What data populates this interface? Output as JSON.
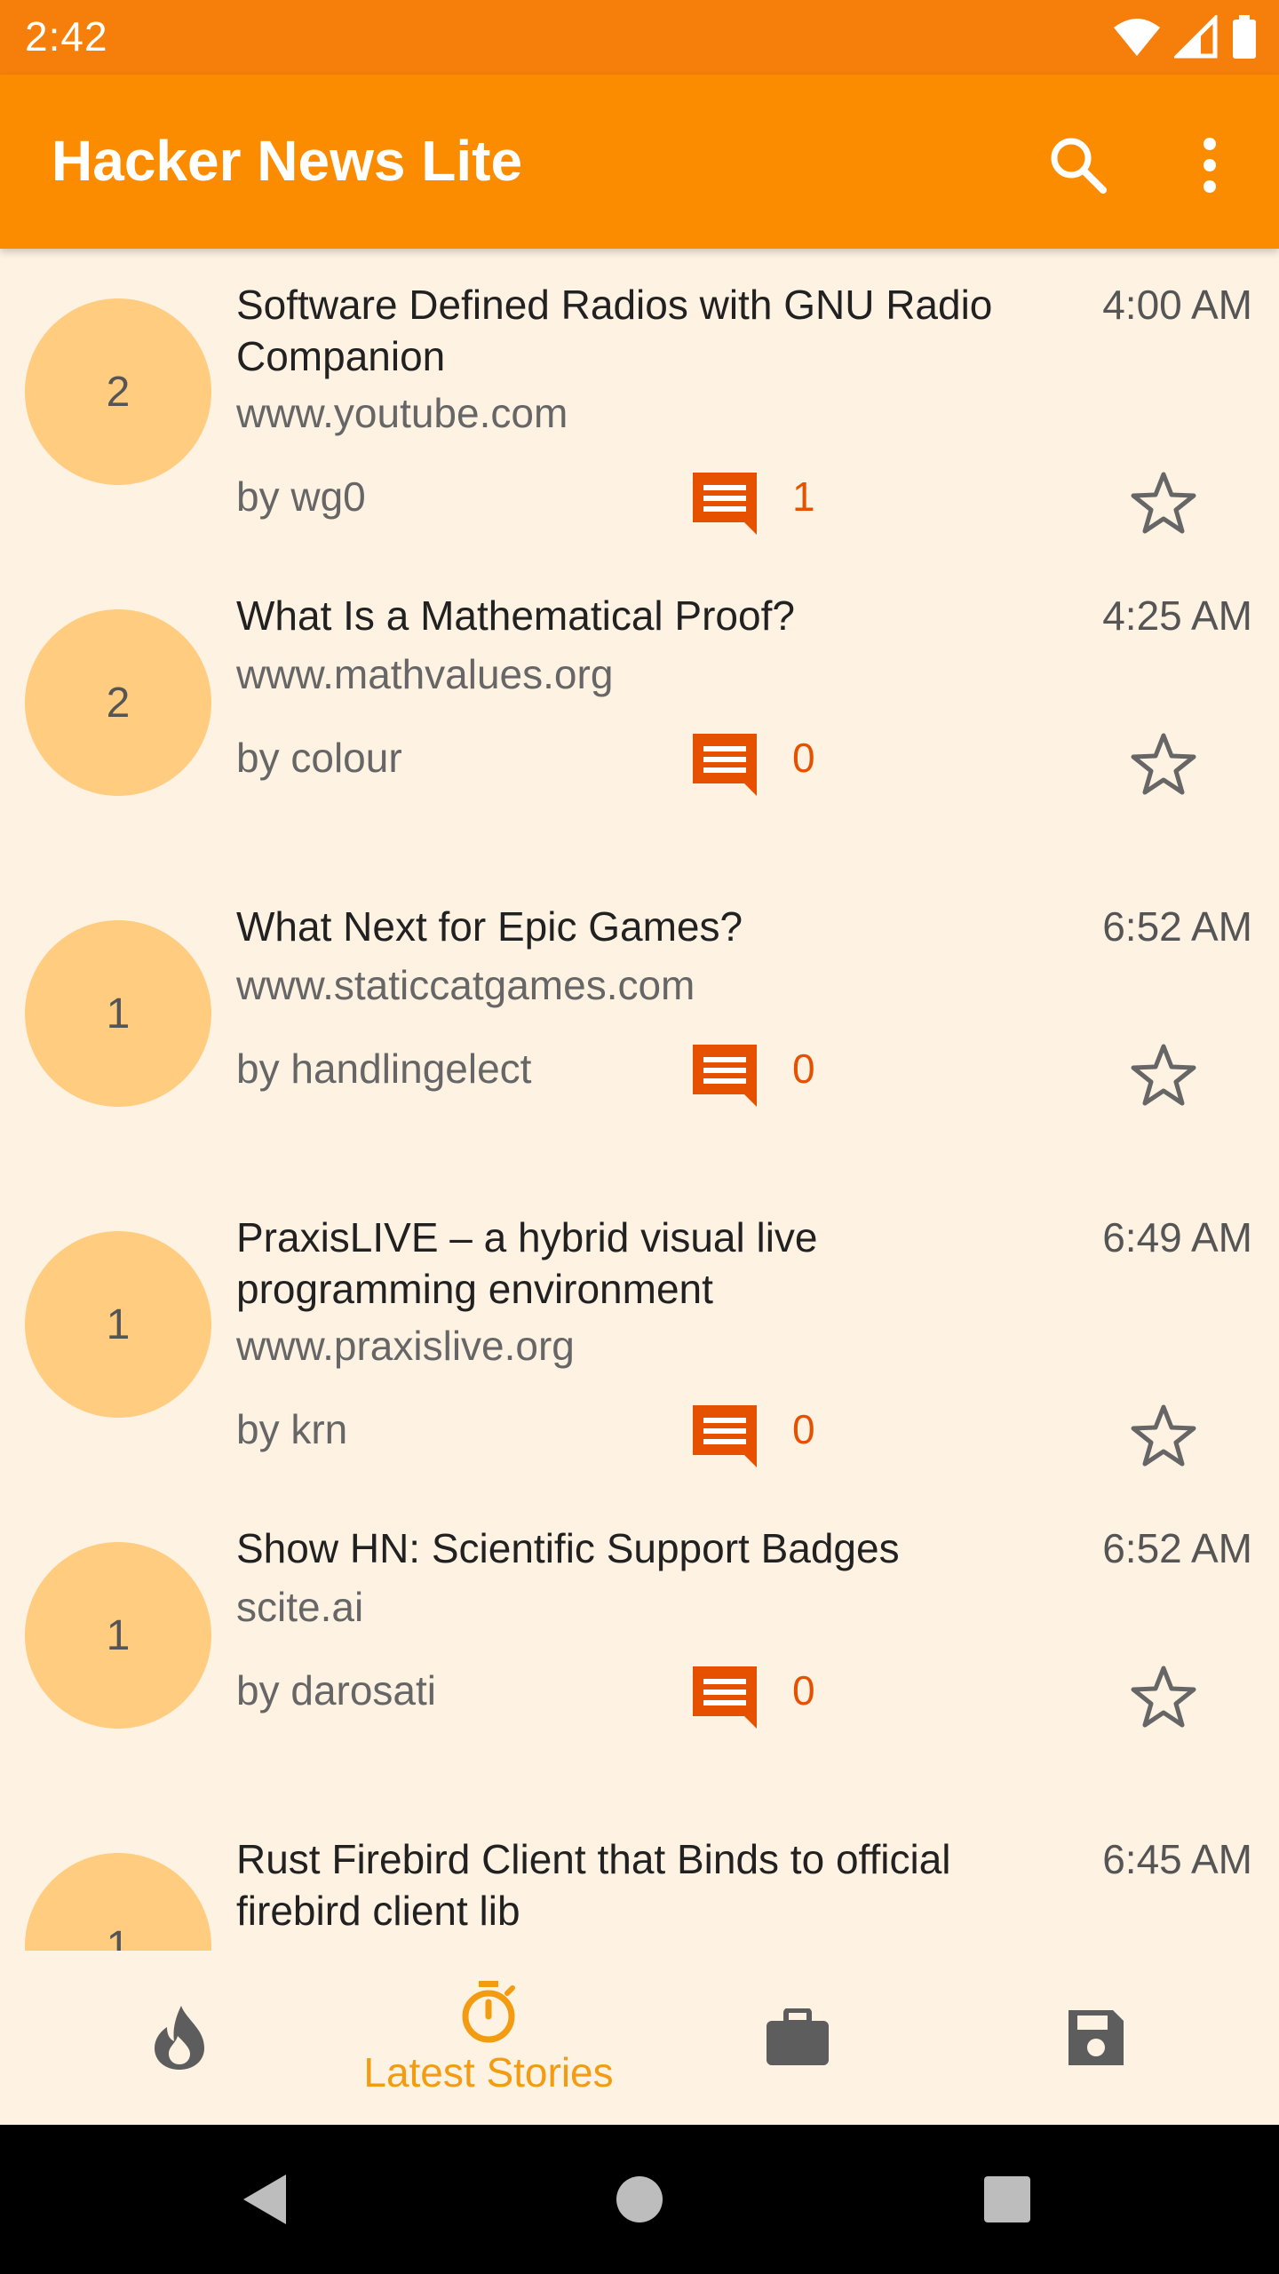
{
  "status_bar": {
    "time": "2:42"
  },
  "app_bar": {
    "title": "Hacker News Lite"
  },
  "stories": [
    {
      "score": "2",
      "title": "Software Defined Radios with GNU Radio Companion",
      "time": "4:00 AM",
      "domain": "www.youtube.com",
      "author": "by wg0",
      "comments": "1"
    },
    {
      "score": "2",
      "title": "What Is a Mathematical Proof?",
      "time": "4:25 AM",
      "domain": "www.mathvalues.org",
      "author": "by colour",
      "comments": "0"
    },
    {
      "score": "1",
      "title": "What Next for Epic Games?",
      "time": "6:52 AM",
      "domain": "www.staticcatgames.com",
      "author": "by handlingelect",
      "comments": "0"
    },
    {
      "score": "1",
      "title": "PraxisLIVE – a hybrid visual live programming environment",
      "time": "6:49 AM",
      "domain": "www.praxislive.org",
      "author": "by krn",
      "comments": "0"
    },
    {
      "score": "1",
      "title": "Show HN: Scientific Support Badges",
      "time": "6:52 AM",
      "domain": "scite.ai",
      "author": "by darosati",
      "comments": "0"
    },
    {
      "score": "1",
      "title": "Rust Firebird Client that Binds to official firebird client lib",
      "time": "6:45 AM"
    }
  ],
  "bottom_nav": {
    "items": [
      {
        "icon": "flame-icon",
        "label": ""
      },
      {
        "icon": "timer-icon",
        "label": "Latest Stories"
      },
      {
        "icon": "briefcase-icon",
        "label": ""
      },
      {
        "icon": "floppy-disk-icon",
        "label": ""
      }
    ],
    "active_color": "#F39C12",
    "inactive_color": "#5D5D5D"
  },
  "colors": {
    "status_bar": "#F57F0A",
    "app_bar": "#FB8C00",
    "background": "#FEF2E3",
    "score_circle": "#FFCC80",
    "comment_accent": "#E65100"
  }
}
